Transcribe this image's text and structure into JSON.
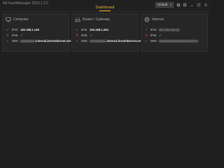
{
  "window": {
    "app_title": "NETworkManager 2023.1.2.0",
    "page_title": "Dashboard"
  },
  "toolbar": {
    "profile_select": "Default",
    "icons": [
      "github-icon",
      "settings-icon",
      "minimize-icon",
      "maximize-icon",
      "close-icon"
    ]
  },
  "cards": [
    {
      "title": "Computer",
      "icon": "monitor-icon",
      "rows": [
        {
          "status": "ok",
          "label": "IPv4",
          "value": "192.168.1.148"
        },
        {
          "status": "bad",
          "label": "IPv6",
          "value": "-/-"
        },
        {
          "status": "ok",
          "label": "DNS",
          "value_prefix": "xxxxxxxxx",
          "value": ".internal.borntoberoot.net"
        }
      ]
    },
    {
      "title": "Router / Gateway",
      "icon": "router-icon",
      "rows": [
        {
          "status": "ok",
          "label": "IPv4",
          "value": "192.168.1.254"
        },
        {
          "status": "bad",
          "label": "IPv6",
          "value": "-/-"
        },
        {
          "status": "ok",
          "label": "DNS",
          "value_prefix": "xxxxxxxxxx",
          "value": ".internal.borntoberoot.net"
        }
      ]
    },
    {
      "title": "Internet",
      "icon": "globe-icon",
      "rows": [
        {
          "status": "ok",
          "label": "IPv4",
          "value_redacted": "xxx.xxx.xxx.xx"
        },
        {
          "status": "bad",
          "label": "IPv6",
          "value": "-/-"
        },
        {
          "status": "ok",
          "label": "DNS",
          "value_redacted": "xxxxxxxxxxxxxxxxxxxxxxxx"
        }
      ]
    }
  ],
  "colors": {
    "accent": "#f2b327",
    "ok": "#3bd06a",
    "bad": "#e04a4a"
  }
}
